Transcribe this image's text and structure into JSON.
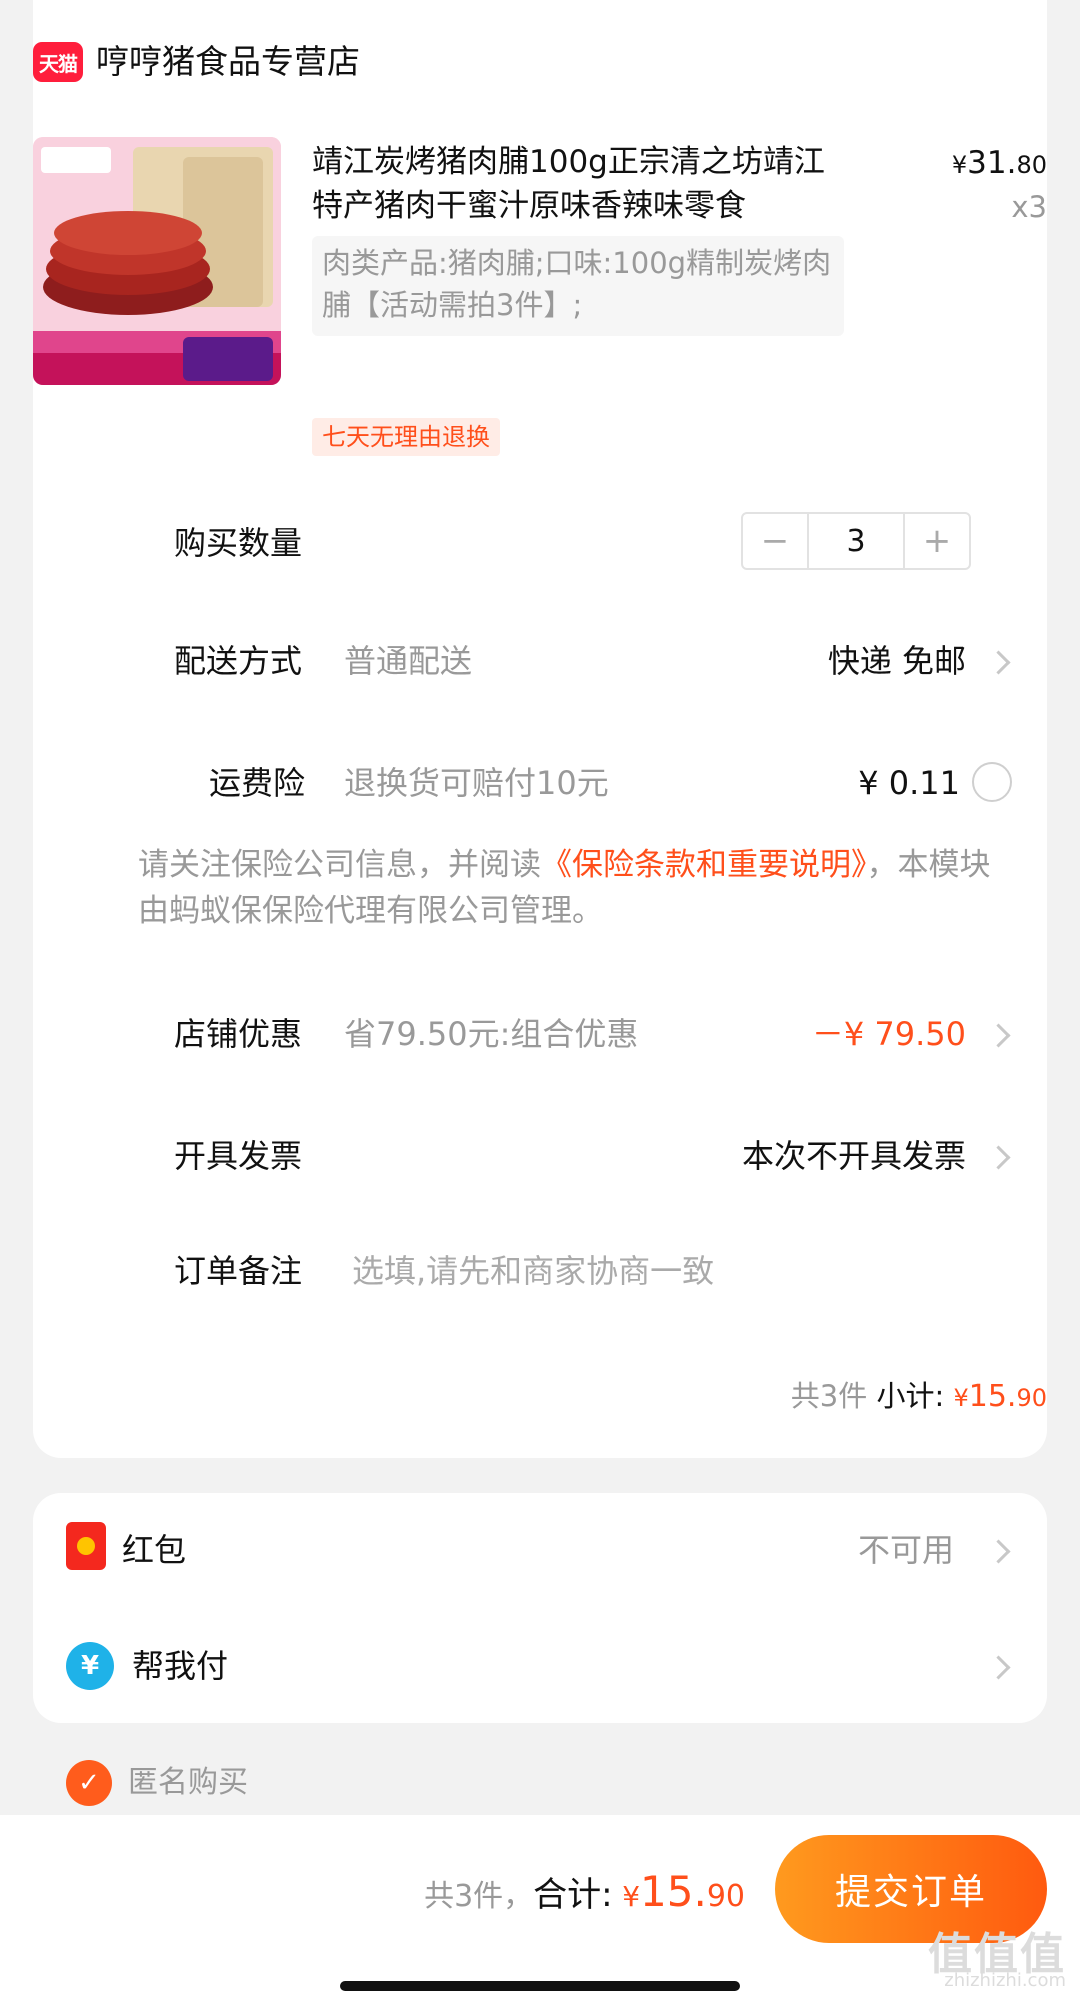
{
  "store": {
    "badge": "天猫",
    "name": "哼哼猪食品专营店"
  },
  "product": {
    "image_icon": "jerky-product-image",
    "title": "靖江炭烤猪肉脯100g正宗清之坊靖江特产猪肉干蜜汁原味香辣味零食",
    "price_symbol": "¥",
    "price_int": "31.",
    "price_dec": "80",
    "quantity": "x3",
    "sku": "肉类产品:猪肉脯;口味:100g精制炭烤肉脯【活动需拍3件】;",
    "return_tag": "七天无理由退换"
  },
  "rows": {
    "quantity": {
      "label": "购买数量",
      "value": "3",
      "minus": "−",
      "plus": "+"
    },
    "delivery": {
      "label": "配送方式",
      "sub": "普通配送",
      "value": "快递 免邮"
    },
    "insurance": {
      "label": "运费险",
      "sub": "退换货可赔付10元",
      "value": "¥ 0.11"
    },
    "insurance_note": {
      "prefix": "请关注保险公司信息，并阅读",
      "link": "《保险条款和重要说明》",
      "suffix": "，本模块由蚂蚁保保险代理有限公司管理。"
    },
    "discount": {
      "label": "店铺优惠",
      "sub": "省79.50元:组合优惠",
      "value": "－¥ 79.50"
    },
    "invoice": {
      "label": "开具发票",
      "value": "本次不开具发票"
    },
    "remark": {
      "label": "订单备注",
      "placeholder": "选填,请先和商家协商一致"
    }
  },
  "subtotal": {
    "count": "共3件",
    "label": "小计:",
    "symbol": "¥",
    "int": "15.",
    "dec": "90"
  },
  "payment": {
    "redpacket": {
      "label": "红包",
      "value": "不可用"
    },
    "helppay": {
      "label": "帮我付",
      "icon_text": "¥"
    }
  },
  "anonymous": {
    "label": "匿名购买",
    "checked": true
  },
  "footer": {
    "count": "共3件，",
    "total_label": "合计:",
    "symbol": "¥",
    "int": "15.",
    "dec": "90",
    "submit": "提交订单"
  },
  "watermark": {
    "main": "值值值",
    "sub": "zhizhizhi.com"
  },
  "colors": {
    "accent": "#ff4f1b",
    "button_start": "#ff9a1e",
    "button_end": "#ff5a0f",
    "tmall": "#ff1e3c"
  }
}
